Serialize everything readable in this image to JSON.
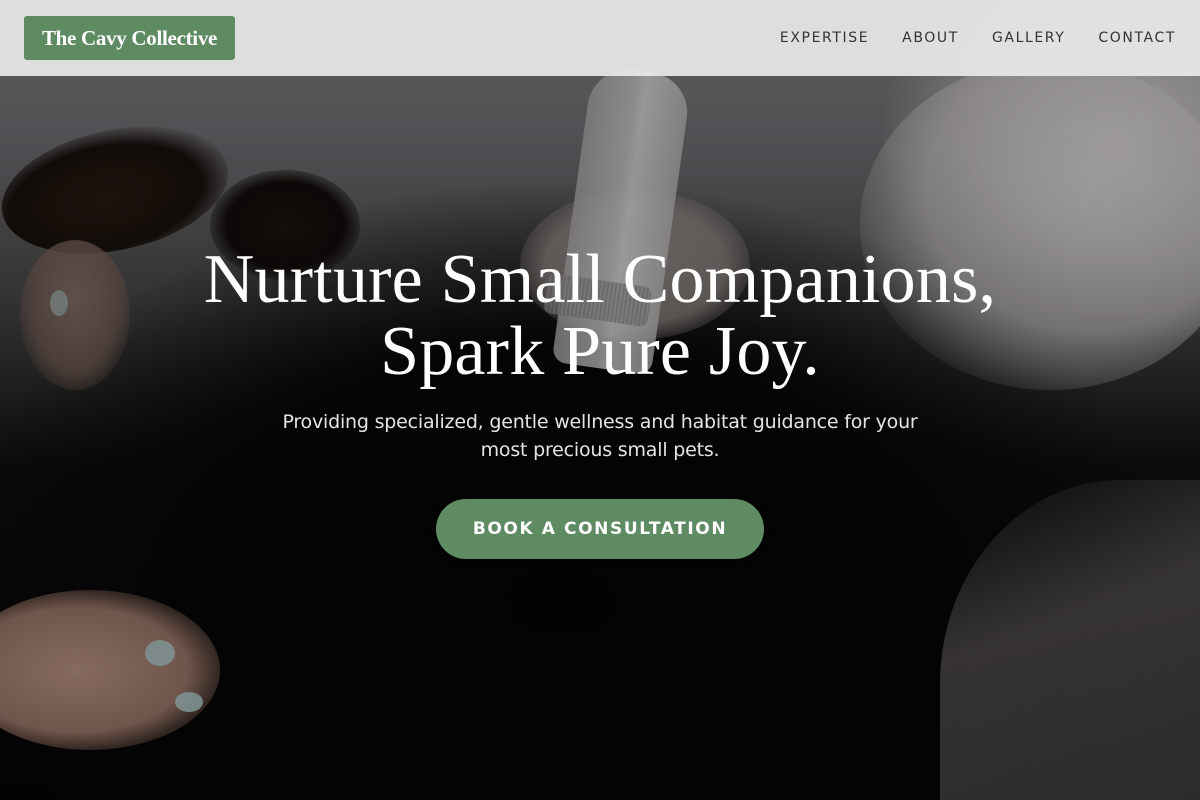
{
  "header": {
    "brand": "The Cavy Collective",
    "nav": [
      {
        "label": "EXPERTISE"
      },
      {
        "label": "ABOUT"
      },
      {
        "label": "GALLERY"
      },
      {
        "label": "CONTACT"
      }
    ]
  },
  "hero": {
    "title_line1": "Nurture Small Companions,",
    "title_line2": "Spark Pure Joy.",
    "subtitle": "Providing specialized, gentle wellness and habitat guidance for your most precious small pets.",
    "cta_label": "BOOK A CONSULTATION"
  },
  "colors": {
    "brand_green": "#5f8b63",
    "header_bg": "#e8e8e8",
    "nav_text": "#2f3437",
    "hero_text": "#ffffff"
  }
}
